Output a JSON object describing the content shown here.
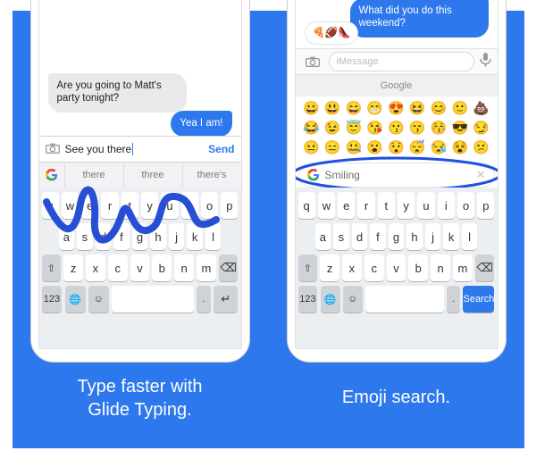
{
  "left": {
    "chat": {
      "incoming": "Are you going to Matt's party tonight?",
      "outgoing": "Yea I am!"
    },
    "compose": {
      "text": "See you there",
      "send_label": "Send"
    },
    "suggestions": [
      "there",
      "three",
      "there's"
    ]
  },
  "right": {
    "chat": {
      "incoming_blue": "What did you do this weekend?",
      "outgoing_emoji": "🍕🏈👠"
    },
    "compose_placeholder": "iMessage",
    "emoji_header": "Google",
    "emoji_search_text": "Smiling",
    "emojis": [
      "😀",
      "😃",
      "😄",
      "😁",
      "😍",
      "😆",
      "😊",
      "🙂",
      "💩",
      "😂",
      "😉",
      "😇",
      "😘",
      "😗",
      "😙",
      "😚",
      "😎",
      "😏",
      "😐",
      "😑",
      "🤐",
      "😮",
      "😯",
      "😴",
      "😪",
      "😵",
      "😕"
    ]
  },
  "keyboard": {
    "row1": [
      "q",
      "w",
      "e",
      "r",
      "t",
      "y",
      "u",
      "i",
      "o",
      "p"
    ],
    "row2": [
      "a",
      "s",
      "d",
      "f",
      "g",
      "h",
      "j",
      "k",
      "l"
    ],
    "row3": [
      "z",
      "x",
      "c",
      "v",
      "b",
      "n",
      "m"
    ],
    "num_label": "123",
    "search_label": "Search"
  },
  "captions": {
    "left_line1": "Type faster with",
    "left_line2": "Glide Typing.",
    "right": "Emoji search."
  },
  "colors": {
    "brand": "#2d78ec"
  }
}
